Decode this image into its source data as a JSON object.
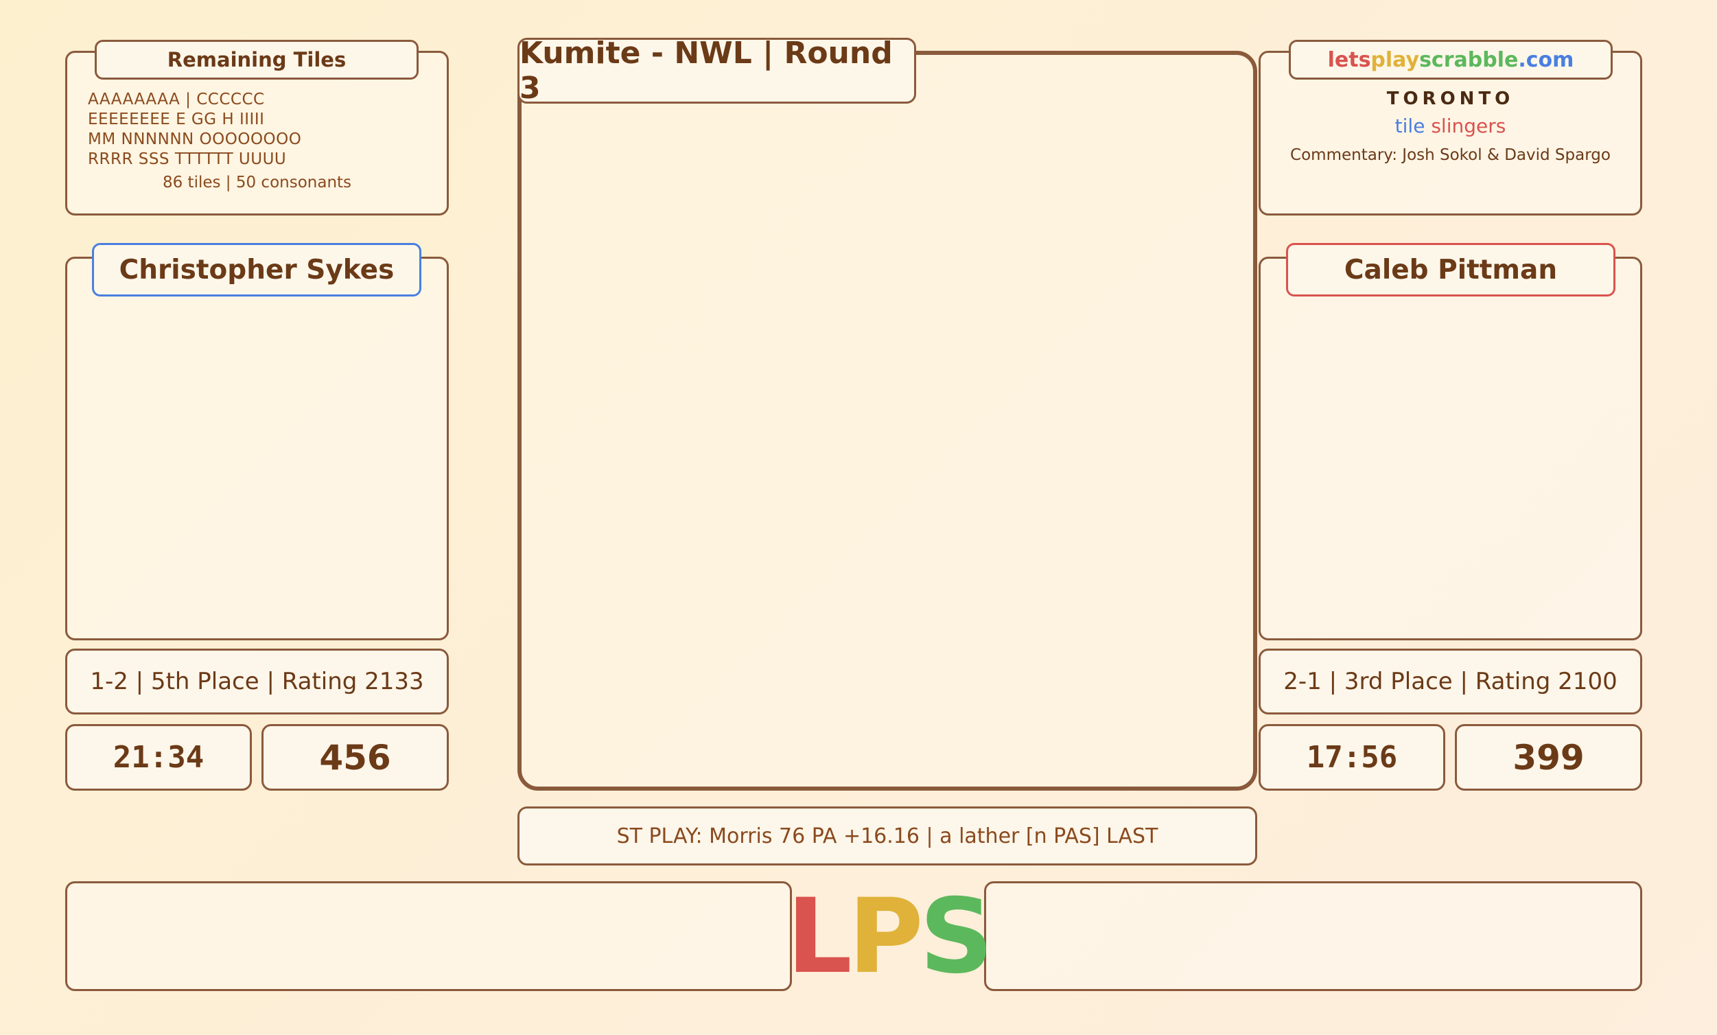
{
  "remaining": {
    "title": "Remaining Tiles",
    "lines": [
      "AAAAAAAA | CCCCCC",
      "EEEEEEEE E GG H IIIII",
      "MM NNNNNN OOOOOOOO",
      "RRRR SSS TTTTTT UUUU"
    ],
    "summary": "86 tiles | 50 consonants"
  },
  "board": {
    "title": "Kumite - NWL | Round 3"
  },
  "brand": {
    "site_parts": [
      {
        "text": "lets",
        "color": "#d9534f"
      },
      {
        "text": "play",
        "color": "#e0b23a"
      },
      {
        "text": "scrabble",
        "color": "#5cb85c"
      },
      {
        "text": ".com",
        "color": "#4a7fe0"
      }
    ],
    "city": "TORONTO",
    "group_word1": "tile",
    "group_word2": "slingers",
    "commentary": "Commentary: Josh Sokol & David Spargo"
  },
  "player1": {
    "name": "Christopher Sykes",
    "accent": "#4a7fe0",
    "record": "1-2 | 5th Place | Rating 2133",
    "clock": "21:34",
    "score": "456"
  },
  "player2": {
    "name": "Caleb Pittman",
    "accent": "#d9534f",
    "record": "2-1 | 3rd Place | Rating 2100",
    "clock": "17:56",
    "score": "399"
  },
  "ticker": {
    "text": "ST PLAY: Morris 76 PA +16.16 | a lather [n PAS] LAST"
  },
  "logo": {
    "letters": [
      {
        "text": "L",
        "color": "#d9534f"
      },
      {
        "text": "P",
        "color": "#e0b23a"
      },
      {
        "text": "S",
        "color": "#5cb85c"
      }
    ]
  }
}
